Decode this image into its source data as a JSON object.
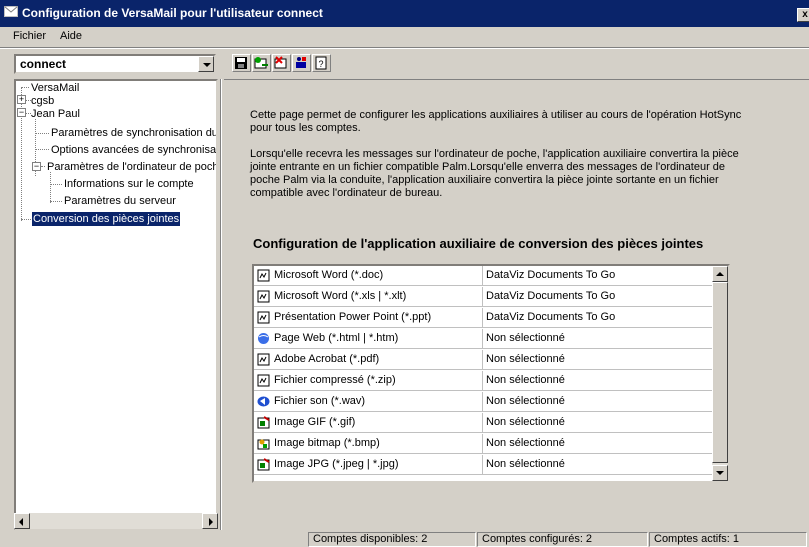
{
  "window": {
    "title": "Configuration de VersaMail pour l'utilisateur connect",
    "close_label": "x"
  },
  "menu": {
    "items": [
      "Fichier",
      "Aide"
    ]
  },
  "user_select": {
    "value": "connect"
  },
  "toolbar": {
    "buttons": [
      "save-icon",
      "add-icon",
      "delete-icon",
      "install-icon",
      "help-icon"
    ]
  },
  "tree": {
    "nodes": [
      {
        "label": "VersaMail"
      },
      {
        "label": "cgsb",
        "expander": "+"
      },
      {
        "label": "Jean Paul",
        "expander": "−"
      },
      {
        "label": "Paramètres de synchronisation du compte"
      },
      {
        "label": "Options avancées de synchronisation"
      },
      {
        "label": "Paramètres de l'ordinateur de poche",
        "expander": "−"
      },
      {
        "label": "Informations sur le compte"
      },
      {
        "label": "Paramètres du serveur"
      },
      {
        "label": "Conversion des pièces jointes"
      }
    ]
  },
  "main": {
    "intro_1": "Cette page permet de configurer les applications auxiliaires à utiliser au cours de l'opération HotSync pour tous les comptes.",
    "intro_2": "Lorsqu'elle recevra les messages sur l'ordinateur de poche, l'application auxiliaire convertira la pièce jointe entrante en un fichier compatible Palm.Lorsqu'elle enverra des messages de l'ordinateur de poche Palm via la conduite, l'application auxiliaire convertira la pièce jointe sortante en un fichier compatible avec l'ordinateur de bureau.",
    "section_title": "Configuration de l'application auxiliaire de conversion des pièces jointes"
  },
  "attachments": [
    {
      "type": "Microsoft Word (*.doc)",
      "app": "DataViz Documents To Go",
      "icon": "doc-icon"
    },
    {
      "type": "Microsoft Word (*.xls | *.xlt)",
      "app": "DataViz Documents To Go",
      "icon": "doc-icon"
    },
    {
      "type": "Présentation Power Point (*.ppt)",
      "app": "DataViz Documents To Go",
      "icon": "doc-icon"
    },
    {
      "type": "Page Web (*.html | *.htm)",
      "app": "Non sélectionné",
      "icon": "web-icon"
    },
    {
      "type": "Adobe Acrobat (*.pdf)",
      "app": "Non sélectionné",
      "icon": "doc-icon"
    },
    {
      "type": "Fichier compressé (*.zip)",
      "app": "Non sélectionné",
      "icon": "doc-icon"
    },
    {
      "type": "Fichier son (*.wav)",
      "app": "Non sélectionné",
      "icon": "sound-icon"
    },
    {
      "type": "Image GIF (*.gif)",
      "app": "Non sélectionné",
      "icon": "image-icon"
    },
    {
      "type": "Image bitmap (*.bmp)",
      "app": "Non sélectionné",
      "icon": "paint-icon"
    },
    {
      "type": "Image JPG (*.jpeg | *.jpg)",
      "app": "Non sélectionné",
      "icon": "image-icon"
    }
  ],
  "status": {
    "available": "Comptes disponibles: 2",
    "configured": "Comptes configurés: 2",
    "active": "Comptes actifs: 1"
  },
  "colors": {
    "title_bar": "#0a246a",
    "window_bg": "#d4d0c8",
    "selection": "#0a246a"
  }
}
